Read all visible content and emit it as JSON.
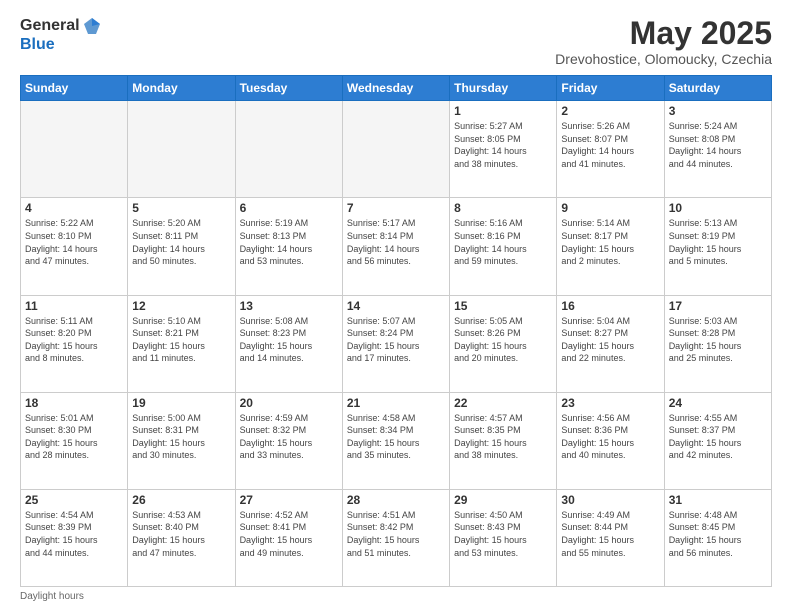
{
  "header": {
    "logo_general": "General",
    "logo_blue": "Blue",
    "title": "May 2025",
    "subtitle": "Drevohostice, Olomoucky, Czechia"
  },
  "days_of_week": [
    "Sunday",
    "Monday",
    "Tuesday",
    "Wednesday",
    "Thursday",
    "Friday",
    "Saturday"
  ],
  "weeks": [
    [
      {
        "day": "",
        "info": ""
      },
      {
        "day": "",
        "info": ""
      },
      {
        "day": "",
        "info": ""
      },
      {
        "day": "",
        "info": ""
      },
      {
        "day": "1",
        "info": "Sunrise: 5:27 AM\nSunset: 8:05 PM\nDaylight: 14 hours\nand 38 minutes."
      },
      {
        "day": "2",
        "info": "Sunrise: 5:26 AM\nSunset: 8:07 PM\nDaylight: 14 hours\nand 41 minutes."
      },
      {
        "day": "3",
        "info": "Sunrise: 5:24 AM\nSunset: 8:08 PM\nDaylight: 14 hours\nand 44 minutes."
      }
    ],
    [
      {
        "day": "4",
        "info": "Sunrise: 5:22 AM\nSunset: 8:10 PM\nDaylight: 14 hours\nand 47 minutes."
      },
      {
        "day": "5",
        "info": "Sunrise: 5:20 AM\nSunset: 8:11 PM\nDaylight: 14 hours\nand 50 minutes."
      },
      {
        "day": "6",
        "info": "Sunrise: 5:19 AM\nSunset: 8:13 PM\nDaylight: 14 hours\nand 53 minutes."
      },
      {
        "day": "7",
        "info": "Sunrise: 5:17 AM\nSunset: 8:14 PM\nDaylight: 14 hours\nand 56 minutes."
      },
      {
        "day": "8",
        "info": "Sunrise: 5:16 AM\nSunset: 8:16 PM\nDaylight: 14 hours\nand 59 minutes."
      },
      {
        "day": "9",
        "info": "Sunrise: 5:14 AM\nSunset: 8:17 PM\nDaylight: 15 hours\nand 2 minutes."
      },
      {
        "day": "10",
        "info": "Sunrise: 5:13 AM\nSunset: 8:19 PM\nDaylight: 15 hours\nand 5 minutes."
      }
    ],
    [
      {
        "day": "11",
        "info": "Sunrise: 5:11 AM\nSunset: 8:20 PM\nDaylight: 15 hours\nand 8 minutes."
      },
      {
        "day": "12",
        "info": "Sunrise: 5:10 AM\nSunset: 8:21 PM\nDaylight: 15 hours\nand 11 minutes."
      },
      {
        "day": "13",
        "info": "Sunrise: 5:08 AM\nSunset: 8:23 PM\nDaylight: 15 hours\nand 14 minutes."
      },
      {
        "day": "14",
        "info": "Sunrise: 5:07 AM\nSunset: 8:24 PM\nDaylight: 15 hours\nand 17 minutes."
      },
      {
        "day": "15",
        "info": "Sunrise: 5:05 AM\nSunset: 8:26 PM\nDaylight: 15 hours\nand 20 minutes."
      },
      {
        "day": "16",
        "info": "Sunrise: 5:04 AM\nSunset: 8:27 PM\nDaylight: 15 hours\nand 22 minutes."
      },
      {
        "day": "17",
        "info": "Sunrise: 5:03 AM\nSunset: 8:28 PM\nDaylight: 15 hours\nand 25 minutes."
      }
    ],
    [
      {
        "day": "18",
        "info": "Sunrise: 5:01 AM\nSunset: 8:30 PM\nDaylight: 15 hours\nand 28 minutes."
      },
      {
        "day": "19",
        "info": "Sunrise: 5:00 AM\nSunset: 8:31 PM\nDaylight: 15 hours\nand 30 minutes."
      },
      {
        "day": "20",
        "info": "Sunrise: 4:59 AM\nSunset: 8:32 PM\nDaylight: 15 hours\nand 33 minutes."
      },
      {
        "day": "21",
        "info": "Sunrise: 4:58 AM\nSunset: 8:34 PM\nDaylight: 15 hours\nand 35 minutes."
      },
      {
        "day": "22",
        "info": "Sunrise: 4:57 AM\nSunset: 8:35 PM\nDaylight: 15 hours\nand 38 minutes."
      },
      {
        "day": "23",
        "info": "Sunrise: 4:56 AM\nSunset: 8:36 PM\nDaylight: 15 hours\nand 40 minutes."
      },
      {
        "day": "24",
        "info": "Sunrise: 4:55 AM\nSunset: 8:37 PM\nDaylight: 15 hours\nand 42 minutes."
      }
    ],
    [
      {
        "day": "25",
        "info": "Sunrise: 4:54 AM\nSunset: 8:39 PM\nDaylight: 15 hours\nand 44 minutes."
      },
      {
        "day": "26",
        "info": "Sunrise: 4:53 AM\nSunset: 8:40 PM\nDaylight: 15 hours\nand 47 minutes."
      },
      {
        "day": "27",
        "info": "Sunrise: 4:52 AM\nSunset: 8:41 PM\nDaylight: 15 hours\nand 49 minutes."
      },
      {
        "day": "28",
        "info": "Sunrise: 4:51 AM\nSunset: 8:42 PM\nDaylight: 15 hours\nand 51 minutes."
      },
      {
        "day": "29",
        "info": "Sunrise: 4:50 AM\nSunset: 8:43 PM\nDaylight: 15 hours\nand 53 minutes."
      },
      {
        "day": "30",
        "info": "Sunrise: 4:49 AM\nSunset: 8:44 PM\nDaylight: 15 hours\nand 55 minutes."
      },
      {
        "day": "31",
        "info": "Sunrise: 4:48 AM\nSunset: 8:45 PM\nDaylight: 15 hours\nand 56 minutes."
      }
    ]
  ],
  "footer": {
    "note": "Daylight hours"
  }
}
